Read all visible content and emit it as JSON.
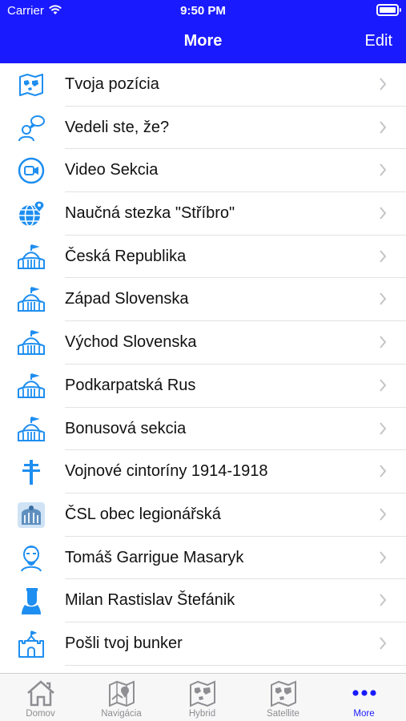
{
  "status_bar": {
    "carrier": "Carrier",
    "time": "9:50 PM"
  },
  "nav": {
    "title": "More",
    "edit_label": "Edit"
  },
  "colors": {
    "accent": "#1a1aff",
    "icon_blue": "#1e8ef0",
    "tab_gray": "#8e8e93"
  },
  "items": [
    {
      "label": "Tvoja pozícia",
      "icon": "map-icon"
    },
    {
      "label": "Vedeli ste, že?",
      "icon": "person-speech-icon"
    },
    {
      "label": "Video Sekcia",
      "icon": "video-camera-icon"
    },
    {
      "label": "Naučná stezka \"Stříbro\"",
      "icon": "globe-pin-icon"
    },
    {
      "label": "Česká Republika",
      "icon": "bunker-icon"
    },
    {
      "label": "Západ Slovenska",
      "icon": "bunker-icon"
    },
    {
      "label": "Východ Slovenska",
      "icon": "bunker-icon"
    },
    {
      "label": "Podkarpatská Rus",
      "icon": "bunker-icon"
    },
    {
      "label": "Bonusová sekcia",
      "icon": "bunker-icon"
    },
    {
      "label": "Vojnové cintoríny 1914-1918",
      "icon": "cross-icon"
    },
    {
      "label": "ČSL obec legionářská",
      "icon": "legion-emblem-icon"
    },
    {
      "label": "Tomáš Garrigue Masaryk",
      "icon": "masaryk-portrait-icon"
    },
    {
      "label": "Milan Rastislav Štefánik",
      "icon": "stefanik-portrait-icon"
    },
    {
      "label": "Pošli tvoj bunker",
      "icon": "castle-icon"
    }
  ],
  "tabs": [
    {
      "label": "Domov",
      "icon": "home-icon",
      "active": false
    },
    {
      "label": "Navigácia",
      "icon": "navigation-map-icon",
      "active": false
    },
    {
      "label": "Hybrid",
      "icon": "hybrid-map-icon",
      "active": false
    },
    {
      "label": "Satellite",
      "icon": "satellite-map-icon",
      "active": false
    },
    {
      "label": "More",
      "icon": "more-dots-icon",
      "active": true
    }
  ]
}
